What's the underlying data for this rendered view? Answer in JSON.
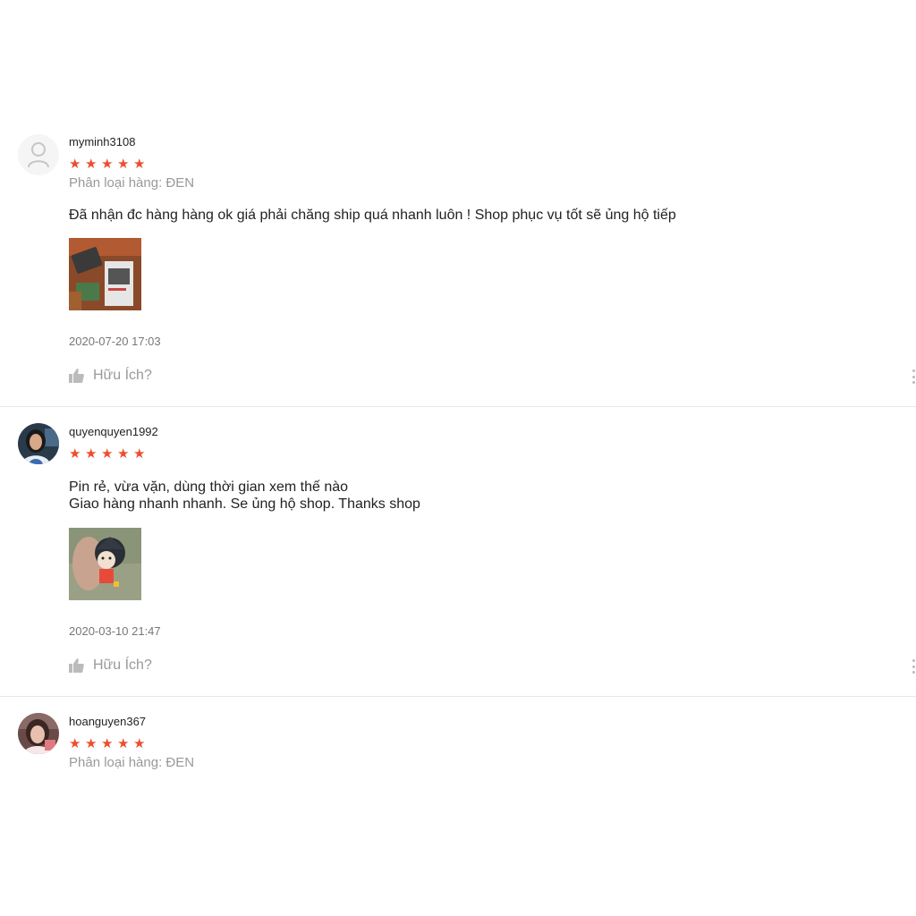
{
  "colors": {
    "star": "#ee4d2d",
    "muted": "#999999",
    "divider": "#e8e8e8"
  },
  "reviews": [
    {
      "username": "myminh3108",
      "rating": 5,
      "variation": "Phân loại hàng: ĐEN",
      "comment": "Đã nhận đc hàng hàng ok giá phải chăng ship quá nhanh luôn ! Shop phục vụ tốt sẽ ủng hộ tiếp",
      "timestamp": "2020-07-20 17:03",
      "helpful_label": "Hữu Ích?",
      "avatar_icon": "default-user-icon",
      "photo_icon": "product-photo"
    },
    {
      "username": "quyenquyen1992",
      "rating": 5,
      "comment": "Pin rẻ, vừa vặn, dùng thời gian xem thế nào\nGiao hàng nhanh nhanh. Se ủng hộ shop. Thanks shop",
      "timestamp": "2020-03-10 21:47",
      "helpful_label": "Hữu Ích?",
      "avatar_icon": "user-photo",
      "photo_icon": "product-photo"
    },
    {
      "username": "hoanguyen367",
      "rating": 5,
      "variation": "Phân loại hàng: ĐEN",
      "avatar_icon": "user-photo"
    }
  ]
}
